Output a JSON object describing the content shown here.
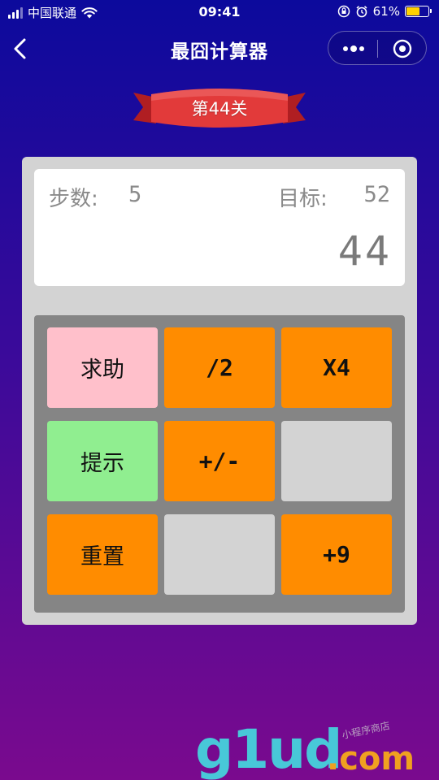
{
  "status_bar": {
    "carrier": "中国联通",
    "time": "09:41",
    "battery": "61%",
    "battery_level": 0.61
  },
  "nav": {
    "title": "最囧计算器"
  },
  "level": {
    "label": "第44关"
  },
  "display": {
    "steps_label": "步数:",
    "steps_value": "5",
    "goal_label": "目标:",
    "goal_value": "52",
    "current_value": "44"
  },
  "keypad": {
    "keys": [
      {
        "label": "求助",
        "color": "#ffc0cb"
      },
      {
        "label": "/2",
        "color": "#ff8c00"
      },
      {
        "label": "X4",
        "color": "#ff8c00"
      },
      {
        "label": "提示",
        "color": "#90ee90"
      },
      {
        "label": "+/-",
        "color": "#ff8c00"
      },
      {
        "label": "",
        "color": "#d3d3d3"
      },
      {
        "label": "重置",
        "color": "#ff8c00"
      },
      {
        "label": "",
        "color": "#d3d3d3"
      },
      {
        "label": "+9",
        "color": "#ff8c00"
      }
    ]
  },
  "watermark": {
    "main": "g1ud",
    "suffix": ".com",
    "tag": "小程序商店"
  },
  "colors": {
    "bg_top": "#0c0a9c",
    "bg_bottom": "#7a0a8e",
    "ribbon": "#e23a3a",
    "key_orange": "#ff8c00",
    "key_pink": "#ffc0cb",
    "key_green": "#90ee90",
    "key_empty": "#d3d3d3"
  }
}
